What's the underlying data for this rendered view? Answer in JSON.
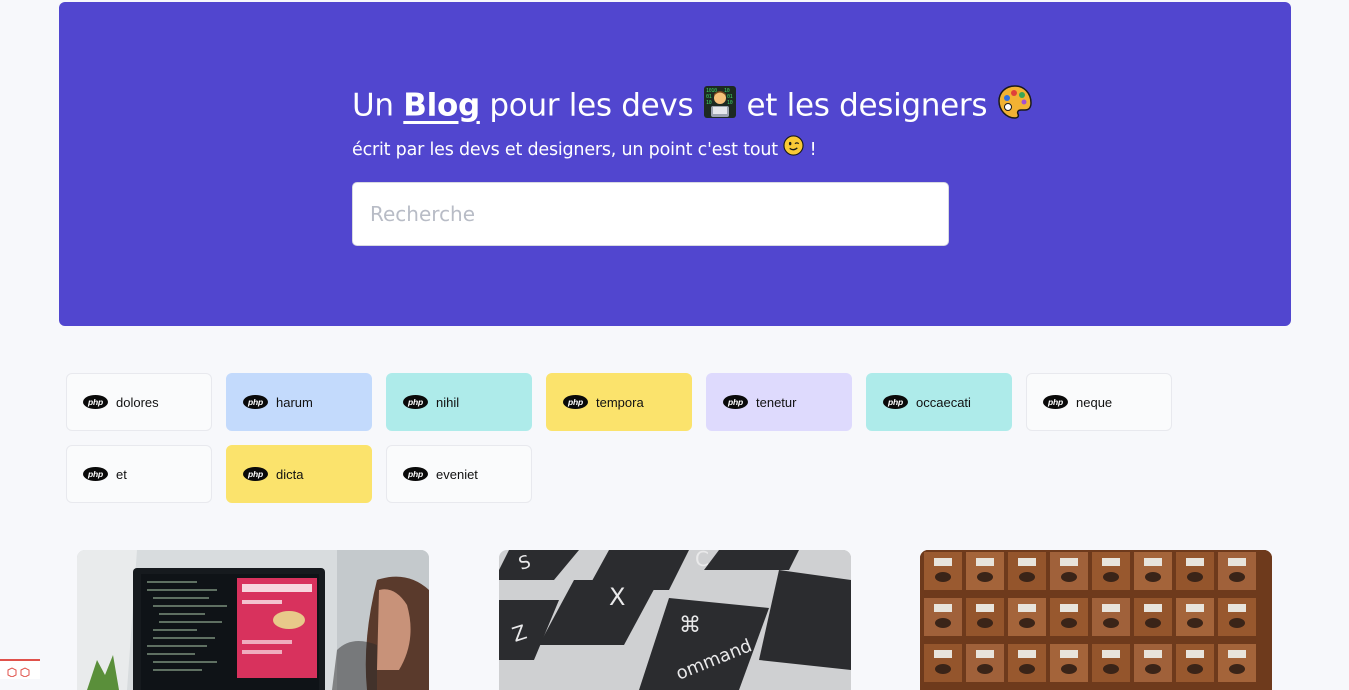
{
  "hero": {
    "title_prefix": "Un ",
    "title_link": "Blog",
    "title_suffix": " pour les devs ",
    "title_suffix2": " et les designers ",
    "subtitle": "écrit par les devs et designers, un point c'est tout ",
    "subtitle_end": " !",
    "emojis": [
      "technologist",
      "artist-palette",
      "winking-face"
    ]
  },
  "search": {
    "placeholder": "Recherche",
    "value": ""
  },
  "tags": [
    {
      "label": "dolores",
      "color": "#fafbfc",
      "icon": "php-icon"
    },
    {
      "label": "harum",
      "color": "#c3dafc",
      "icon": "php-icon"
    },
    {
      "label": "nihil",
      "color": "#aeebea",
      "icon": "php-icon"
    },
    {
      "label": "tempora",
      "color": "#fbe36c",
      "icon": "php-icon"
    },
    {
      "label": "tenetur",
      "color": "#dedafd",
      "icon": "php-icon"
    },
    {
      "label": "occaecati",
      "color": "#aeebea",
      "icon": "php-icon"
    },
    {
      "label": "neque",
      "color": "#fafbfc",
      "icon": "php-icon"
    },
    {
      "label": "et",
      "color": "#fafbfc",
      "icon": "php-icon"
    },
    {
      "label": "dicta",
      "color": "#fbe36c",
      "icon": "php-icon"
    },
    {
      "label": "eveniet",
      "color": "#fafbfc",
      "icon": "php-icon"
    }
  ],
  "php_text": "php",
  "colors": {
    "hero": "#5146cf",
    "background": "#f7f8fb"
  },
  "cards": [
    {
      "image": "developer-laptop-code-photo"
    },
    {
      "image": "keyboard-command-key-photo"
    },
    {
      "image": "wooden-card-catalog-drawers-photo"
    }
  ]
}
